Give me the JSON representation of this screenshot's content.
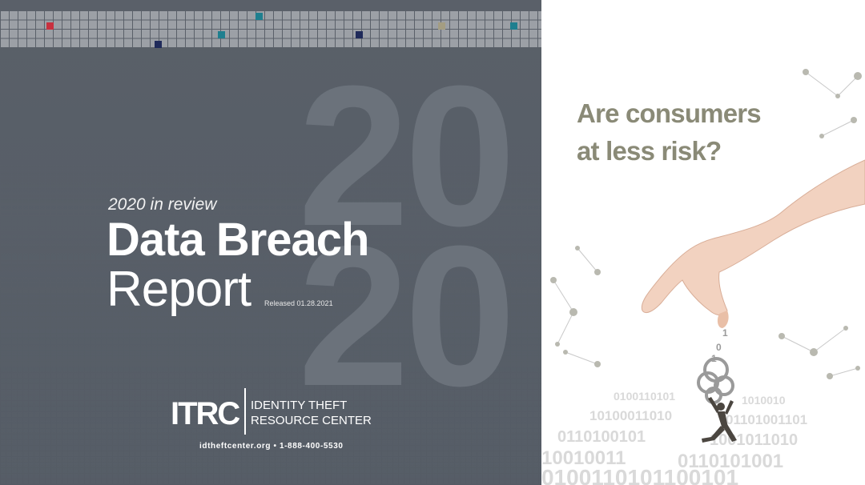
{
  "cover": {
    "subtitle": "2020 in review",
    "title_line1": "Data Breach",
    "title_line2": "Report",
    "released": "Released 01.28.2021",
    "year_top": "20",
    "year_bottom": "20"
  },
  "logo": {
    "mark": "ITRC",
    "name_line1": "IDENTITY THEFT",
    "name_line2": "RESOURCE CENTER"
  },
  "contact": "idtheftcenter.org • 1-888-400-5530",
  "headline": {
    "line1": "Are consumers",
    "line2": "at less risk?"
  },
  "colors": {
    "panel_gray": "#575e67",
    "headline_olive": "#8a8a77",
    "accent_red": "#c8313f",
    "accent_teal": "#1f7f8f",
    "accent_navy": "#1f2a5a",
    "accent_sand": "#a49d82"
  },
  "images": {
    "scene": "hand-lifting-binary-digits-over-running-man"
  }
}
